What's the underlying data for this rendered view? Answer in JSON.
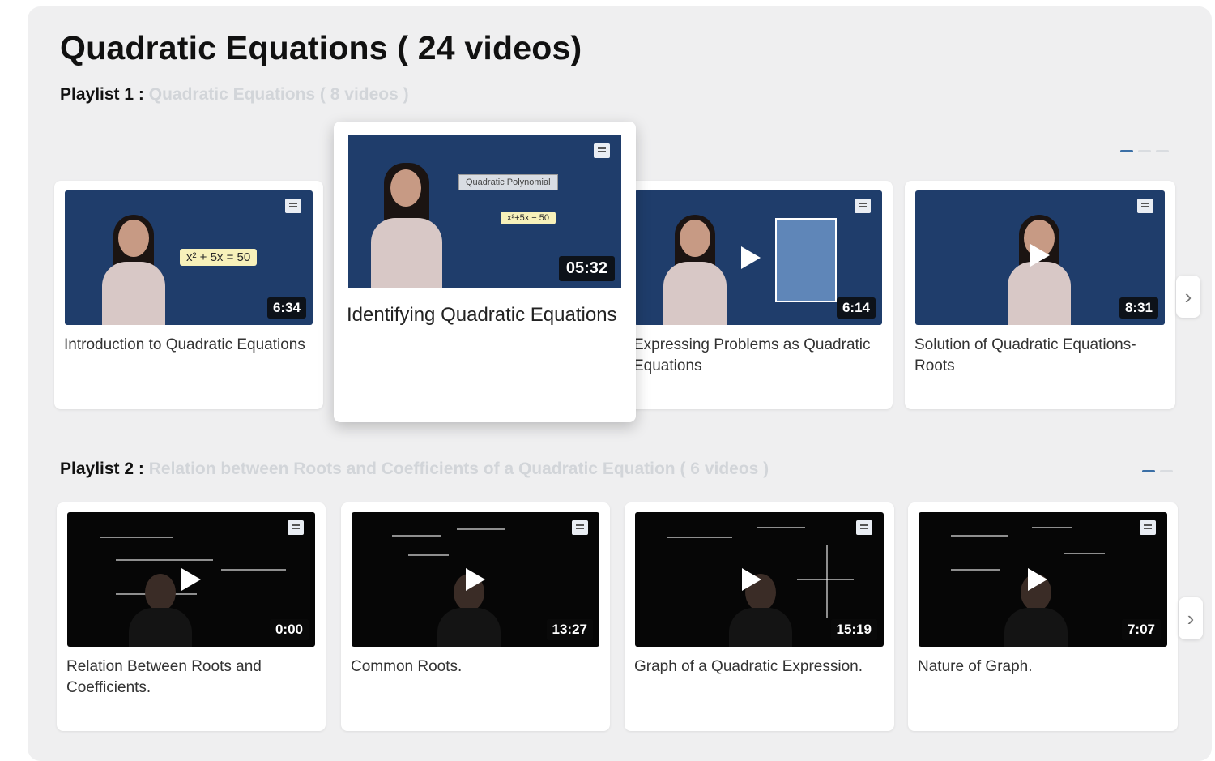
{
  "page": {
    "title": "Quadratic Equations  ( 24 videos)"
  },
  "playlists": [
    {
      "label": "Playlist 1 :",
      "subtitle": "Quadratic Equations ( 8 videos )",
      "videos": [
        {
          "title": "Introduction to Quadratic Equations",
          "duration": "6:34",
          "thumb_text": "x² + 5x = 50"
        },
        {
          "title": "Identifying Quadratic Equations",
          "duration": "05:32",
          "thumb_heading": "Quadratic Polynomial",
          "thumb_text": "x²+5x − 50"
        },
        {
          "title": "Expressing Problems as Quadratic Equations",
          "duration": "6:14"
        },
        {
          "title": "Solution of Quadratic Equations-Roots",
          "duration": "8:31"
        }
      ]
    },
    {
      "label": "Playlist 2 :",
      "subtitle": "Relation between Roots and Coefficients of a Quadratic Equation ( 6 videos )",
      "videos": [
        {
          "title": "Relation Between Roots and Coefficients.",
          "duration": "0:00"
        },
        {
          "title": "Common Roots.",
          "duration": "13:27"
        },
        {
          "title": "Graph of a Quadratic Expression.",
          "duration": "15:19"
        },
        {
          "title": "Nature of Graph.",
          "duration": "7:07"
        }
      ]
    }
  ],
  "icons": {
    "next": "chevron-right-icon",
    "play": "play-icon",
    "save": "save-icon"
  },
  "colors": {
    "thumb_blue": "#1f3d6b",
    "thumb_dark": "#060606",
    "panel_bg": "#efeff0",
    "subtitle_muted": "#d2d5d9",
    "active_dot": "#3b6fa6"
  }
}
